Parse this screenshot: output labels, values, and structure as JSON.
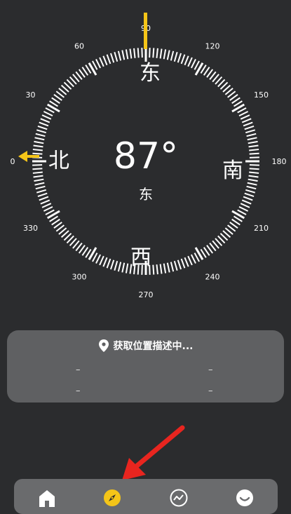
{
  "compass": {
    "heading": "87°",
    "direction": "东",
    "cardinals": {
      "east": "东",
      "south": "南",
      "west": "西",
      "north": "北"
    },
    "scale_labels": [
      {
        "deg": 0,
        "text": "0"
      },
      {
        "deg": 30,
        "text": "30"
      },
      {
        "deg": 60,
        "text": "60"
      },
      {
        "deg": 90,
        "text": "90"
      },
      {
        "deg": 120,
        "text": "120"
      },
      {
        "deg": 150,
        "text": "150"
      },
      {
        "deg": 180,
        "text": "180"
      },
      {
        "deg": 210,
        "text": "210"
      },
      {
        "deg": 240,
        "text": "240"
      },
      {
        "deg": 270,
        "text": "270"
      },
      {
        "deg": 300,
        "text": "300"
      },
      {
        "deg": 330,
        "text": "330"
      }
    ],
    "accent_color": "#f5c518"
  },
  "location": {
    "title": "获取位置描述中...",
    "values": [
      "–",
      "–",
      "–",
      "–"
    ]
  },
  "nav": {
    "items": [
      {
        "name": "home",
        "icon": "home-icon",
        "active": false
      },
      {
        "name": "compass",
        "icon": "compass-icon",
        "active": true
      },
      {
        "name": "trend",
        "icon": "trend-icon",
        "active": false
      },
      {
        "name": "profile",
        "icon": "smile-icon",
        "active": false
      }
    ]
  }
}
